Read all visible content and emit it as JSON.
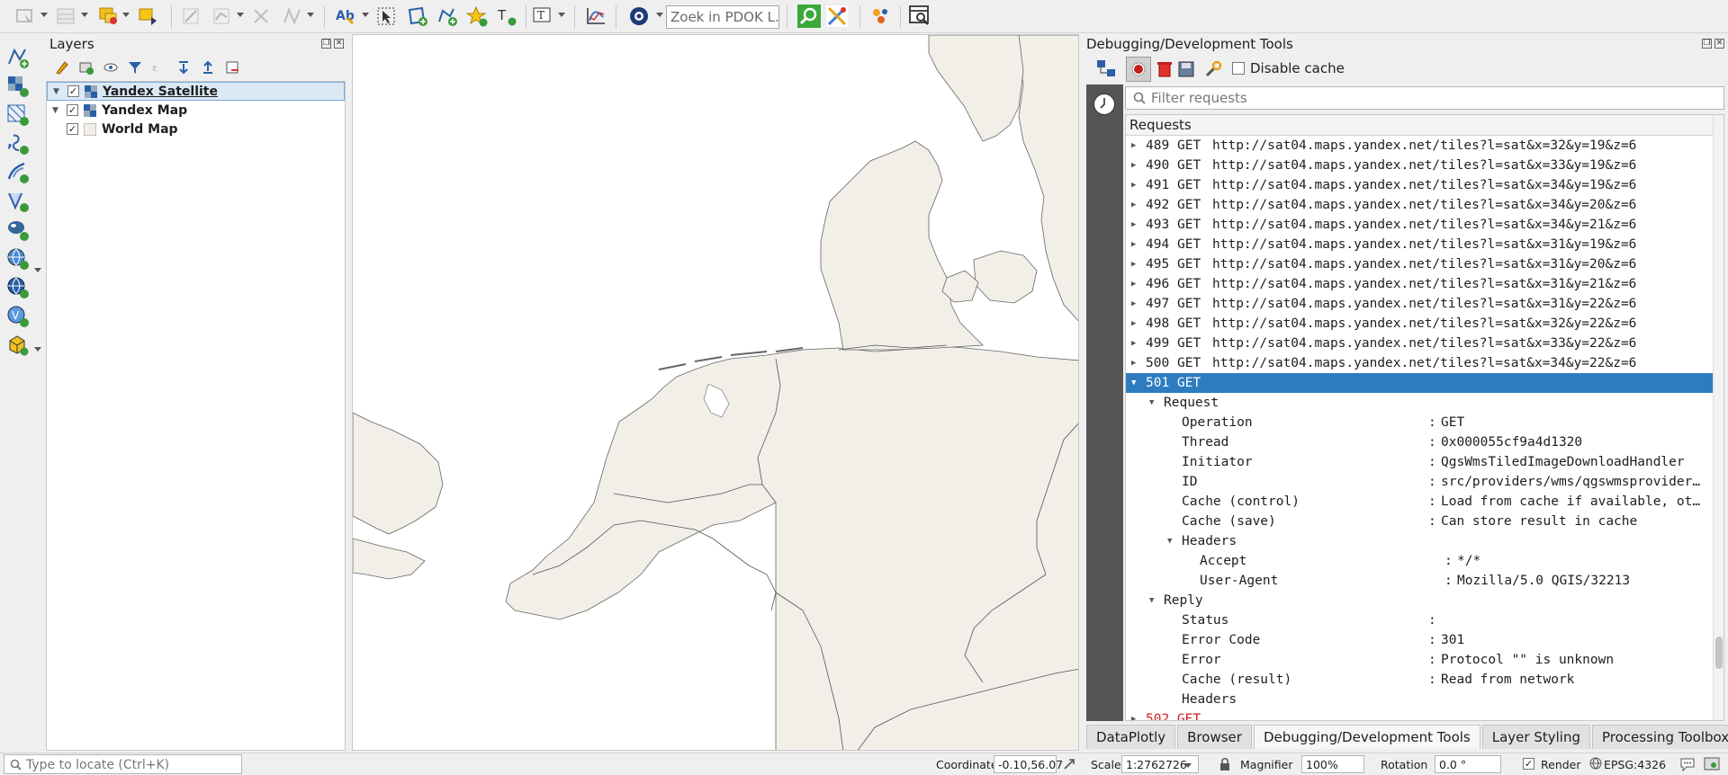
{
  "toolbar": {
    "search_placeholder": "Zoek in PDOK L...",
    "icons": [
      "select-features-icon",
      "attribute-table-icon",
      "deselect-icon",
      "identify-icon",
      "digitize-icon",
      "vertex-tool-icon",
      "node-tool-icon",
      "label-tool-icon",
      "pointer-select-icon",
      "add-polygon-icon",
      "add-line-icon",
      "star-icon",
      "text-annotation-icon",
      "text-tool-icon",
      "chart-icon",
      "plugin-globe-icon",
      "pdok-search-icon",
      "processing-icon",
      "python-icon",
      "debug-icon"
    ]
  },
  "left_toolbar": {
    "icons": [
      "digitize-vector-icon",
      "add-raster-icon",
      "add-mesh-icon",
      "add-delimited-icon",
      "add-vector-tile-icon",
      "add-virtual-layer-icon",
      "add-postgis-icon",
      "add-wms-icon",
      "add-wfs-icon",
      "add-wcs-icon",
      "add-point-cloud-icon"
    ]
  },
  "layers_panel": {
    "title": "Layers",
    "layers": [
      {
        "name": "Yandex Satellite",
        "checked": true,
        "expanded": true,
        "selected": true
      },
      {
        "name": "Yandex Map",
        "checked": true,
        "expanded": true,
        "selected": false
      },
      {
        "name": "World Map",
        "checked": true,
        "expanded": false,
        "selected": false
      }
    ]
  },
  "debug_panel": {
    "title": "Debugging/Development Tools",
    "disable_cache_label": "Disable cache",
    "filter_placeholder": "Filter requests",
    "requests_header": "Requests",
    "requests": [
      {
        "id": "489",
        "method": "GET",
        "url": "http://sat04.maps.yandex.net/tiles?l=sat&x=32&y=19&z=6"
      },
      {
        "id": "490",
        "method": "GET",
        "url": "http://sat04.maps.yandex.net/tiles?l=sat&x=33&y=19&z=6"
      },
      {
        "id": "491",
        "method": "GET",
        "url": "http://sat04.maps.yandex.net/tiles?l=sat&x=34&y=19&z=6"
      },
      {
        "id": "492",
        "method": "GET",
        "url": "http://sat04.maps.yandex.net/tiles?l=sat&x=34&y=20&z=6"
      },
      {
        "id": "493",
        "method": "GET",
        "url": "http://sat04.maps.yandex.net/tiles?l=sat&x=34&y=21&z=6"
      },
      {
        "id": "494",
        "method": "GET",
        "url": "http://sat04.maps.yandex.net/tiles?l=sat&x=31&y=19&z=6"
      },
      {
        "id": "495",
        "method": "GET",
        "url": "http://sat04.maps.yandex.net/tiles?l=sat&x=31&y=20&z=6"
      },
      {
        "id": "496",
        "method": "GET",
        "url": "http://sat04.maps.yandex.net/tiles?l=sat&x=31&y=21&z=6"
      },
      {
        "id": "497",
        "method": "GET",
        "url": "http://sat04.maps.yandex.net/tiles?l=sat&x=31&y=22&z=6"
      },
      {
        "id": "498",
        "method": "GET",
        "url": "http://sat04.maps.yandex.net/tiles?l=sat&x=32&y=22&z=6"
      },
      {
        "id": "499",
        "method": "GET",
        "url": "http://sat04.maps.yandex.net/tiles?l=sat&x=33&y=22&z=6"
      },
      {
        "id": "500",
        "method": "GET",
        "url": "http://sat04.maps.yandex.net/tiles?l=sat&x=34&y=22&z=6"
      }
    ],
    "selected_request": {
      "label": "501 GET",
      "request_section": "Request",
      "request_fields": [
        {
          "key": "Operation",
          "value": "GET"
        },
        {
          "key": "Thread",
          "value": "0x000055cf9a4d1320"
        },
        {
          "key": "Initiator",
          "value": "QgsWmsTiledImageDownloadHandler"
        },
        {
          "key": "ID",
          "value": "src/providers/wms/qgswmsprovider…"
        },
        {
          "key": "Cache (control)",
          "value": "Load from cache if available, ot…"
        },
        {
          "key": "Cache (save)",
          "value": "Can store result in cache"
        }
      ],
      "headers_label": "Headers",
      "header_fields": [
        {
          "key": "Accept",
          "value": "*/*"
        },
        {
          "key": "User-Agent",
          "value": "Mozilla/5.0 QGIS/32213"
        }
      ],
      "reply_section": "Reply",
      "reply_fields": [
        {
          "key": "Status",
          "value": ""
        },
        {
          "key": "Error Code",
          "value": "301"
        },
        {
          "key": "Error",
          "value": "Protocol \"\" is unknown"
        },
        {
          "key": "Cache (result)",
          "value": "Read from network"
        }
      ],
      "reply_headers_label": "Headers"
    },
    "next_request_label": "502 GET"
  },
  "bottom_tabs": [
    "DataPlotly",
    "Browser",
    "Debugging/Development Tools",
    "Layer Styling",
    "Processing Toolbox"
  ],
  "active_tab": "Debugging/Development Tools",
  "status_bar": {
    "locate_placeholder": "Type to locate (Ctrl+K)",
    "coordinate_label": "Coordinate",
    "coordinate_value": "-0.10,56.07",
    "scale_label": "Scale",
    "scale_value": "1:2762726",
    "magnifier_label": "Magnifier",
    "magnifier_value": "100%",
    "rotation_label": "Rotation",
    "rotation_value": "0.0 °",
    "render_label": "Render",
    "crs_label": "EPSG:4326"
  },
  "colors": {
    "land": "#f2efe9",
    "land_dark": "#e8e2d4",
    "border": "#555555",
    "selection": "#2e7cc0",
    "error_red": "#d21e1e"
  }
}
